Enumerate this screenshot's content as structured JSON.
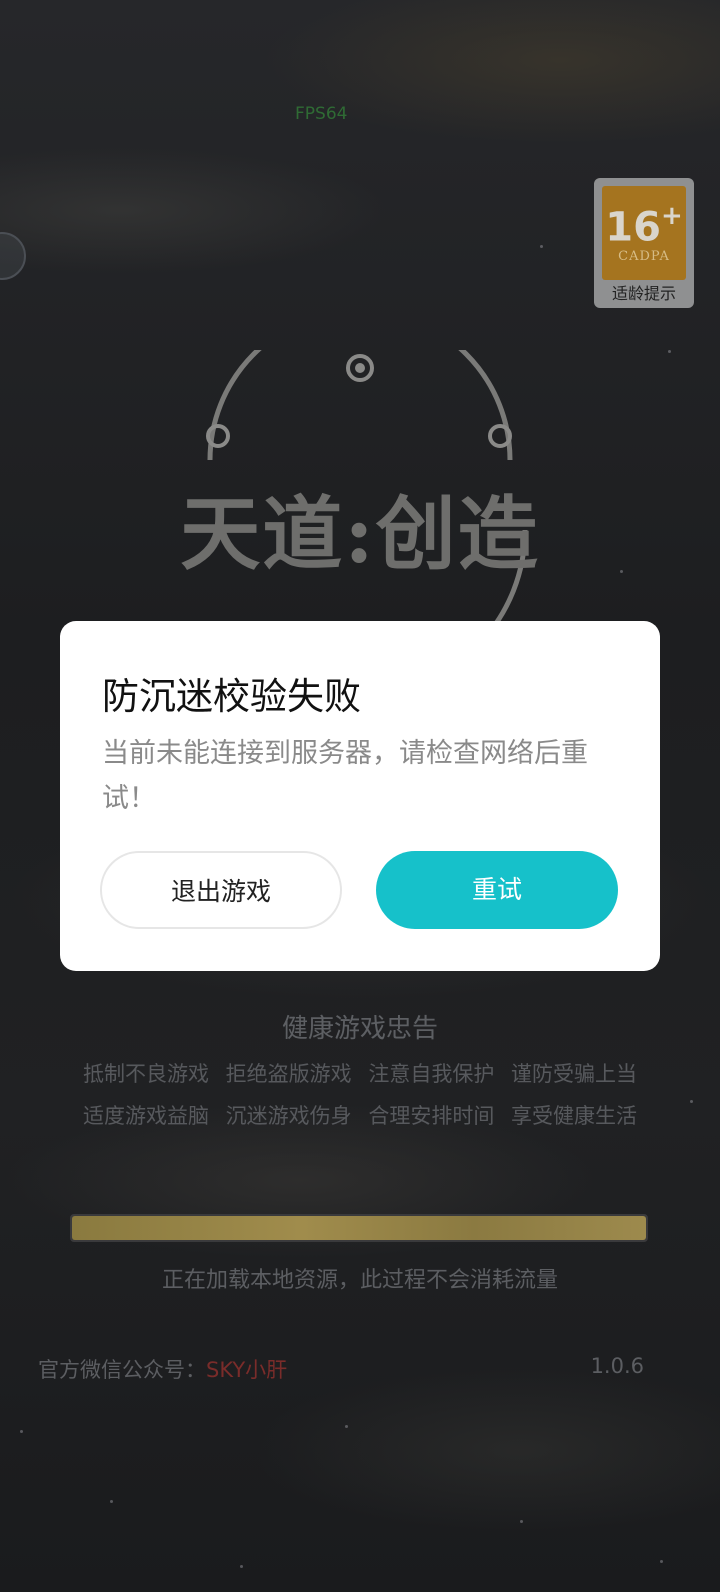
{
  "status": {
    "fps": "FPS64"
  },
  "age_badge": {
    "rating": "16",
    "plus": "+",
    "org": "CADPA",
    "label": "适龄提示",
    "bg_color": "#a5741f"
  },
  "logo": {
    "title": "天道:创造"
  },
  "dialog": {
    "title": "防沉迷校验失败",
    "message": "当前未能连接到服务器，请检查网络后重试！",
    "exit_label": "退出游戏",
    "retry_label": "重试",
    "retry_color": "#16c1ca"
  },
  "health": {
    "title": "健康游戏忠告",
    "line1": "抵制不良游戏 拒绝盗版游戏 注意自我保护 谨防受骗上当",
    "line2": "适度游戏益脑 沉迷游戏伤身 合理安排时间 享受健康生活"
  },
  "loading": {
    "progress": 1.0,
    "text": "正在加载本地资源，此过程不会消耗流量"
  },
  "footer": {
    "wechat_label": "官方微信公众号：",
    "wechat_account": "SKY小肝",
    "version": "1.0.6"
  }
}
